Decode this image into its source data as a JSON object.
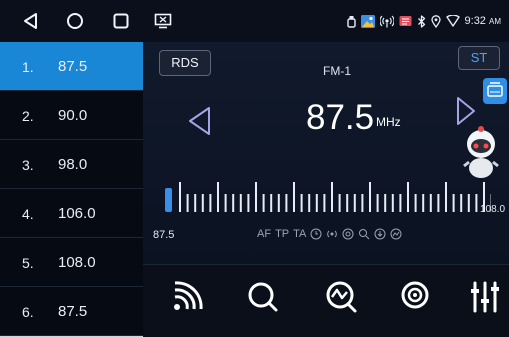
{
  "presets": [
    {
      "num": "1.",
      "freq": "87.5",
      "active": true
    },
    {
      "num": "2.",
      "freq": "90.0"
    },
    {
      "num": "3.",
      "freq": "98.0"
    },
    {
      "num": "4.",
      "freq": "106.0"
    },
    {
      "num": "5.",
      "freq": "108.0"
    },
    {
      "num": "6.",
      "freq": "87.5"
    }
  ],
  "tuner": {
    "rds_label": "RDS",
    "st_label": "ST",
    "band": "FM-1",
    "frequency": "87.5",
    "unit": "MHz",
    "scale_min": "87.5",
    "scale_max": "108.0",
    "flags": [
      "AF",
      "TP",
      "TA"
    ]
  },
  "status": {
    "time": "9:32",
    "ampm": "AM"
  },
  "colors": {
    "accent": "#1a87d6",
    "background": "#0d1422"
  },
  "icons": {
    "nav": [
      "back-icon",
      "home-icon",
      "recents-icon"
    ],
    "bottom": [
      "signal-icon",
      "search-icon",
      "scan-icon",
      "broadcast-icon",
      "equalizer-icon"
    ]
  }
}
